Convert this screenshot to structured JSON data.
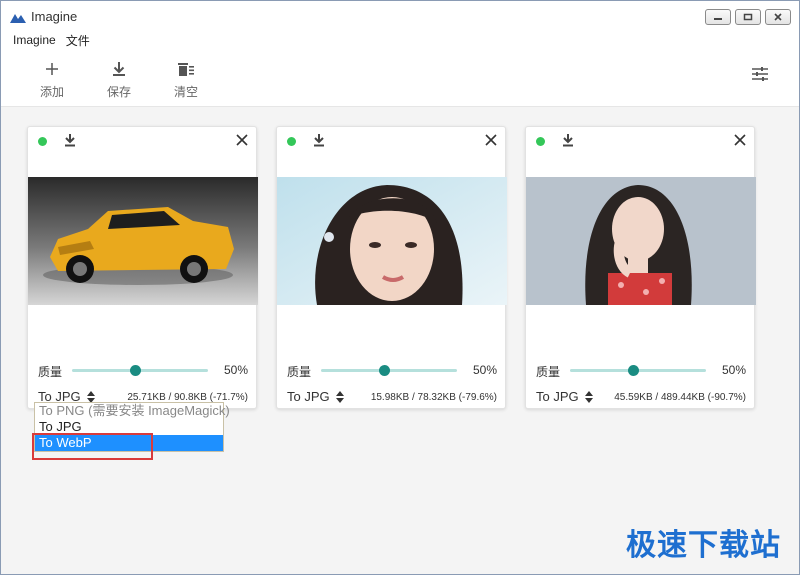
{
  "window": {
    "title": "Imagine"
  },
  "menu": [
    "Imagine",
    "文件"
  ],
  "toolbar": {
    "add": "添加",
    "save": "保存",
    "clear": "清空"
  },
  "cards": [
    {
      "quality_label": "质量",
      "quality": "50%",
      "format": "To JPG",
      "sizes": "25.71KB / 90.8KB (-71.7%)",
      "image": "yellow-suv-photo"
    },
    {
      "quality_label": "质量",
      "quality": "50%",
      "format": "To JPG",
      "sizes": "15.98KB / 78.32KB (-79.6%)",
      "image": "woman-portrait-photo"
    },
    {
      "quality_label": "质量",
      "quality": "50%",
      "format": "To JPG",
      "sizes": "45.59KB / 489.44KB (-90.7%)",
      "image": "woman-red-dress-photo"
    }
  ],
  "format_menu": {
    "options": [
      "To PNG (需要安装 ImageMagick)",
      "To JPG",
      "To WebP"
    ],
    "selected": "To WebP"
  },
  "watermark": "极速下载站",
  "colors": {
    "status": "#34c759",
    "slider_knob": "#1a8c82",
    "slider_track": "#b5e0dc",
    "selection": "#1e90ff",
    "highlight": "#d93b3b"
  }
}
